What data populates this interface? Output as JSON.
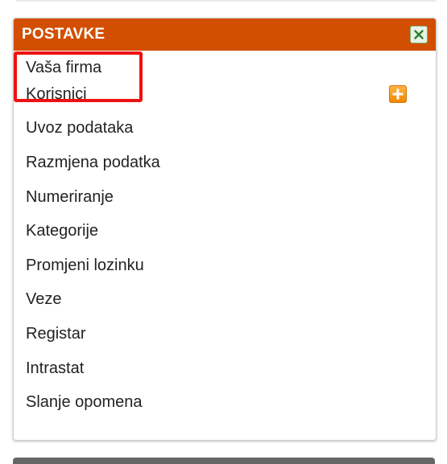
{
  "panel": {
    "title": "POSTAVKE",
    "header_color": "#d24f02",
    "close_icon": "close-x-icon",
    "items": [
      {
        "label": "Vaša firma"
      },
      {
        "label": "Korisnici",
        "action_icon": "add-plus-icon"
      },
      {
        "label": "Uvoz podataka"
      },
      {
        "label": "Razmjena podatka"
      },
      {
        "label": "Numeriranje"
      },
      {
        "label": "Kategorije"
      },
      {
        "label": "Promjeni lozinku"
      },
      {
        "label": "Veze"
      },
      {
        "label": "Registar"
      },
      {
        "label": "Intrastat"
      },
      {
        "label": "Slanje opomena"
      }
    ]
  },
  "highlight": {
    "target": "Vaša firma",
    "color": "#ee1111"
  }
}
